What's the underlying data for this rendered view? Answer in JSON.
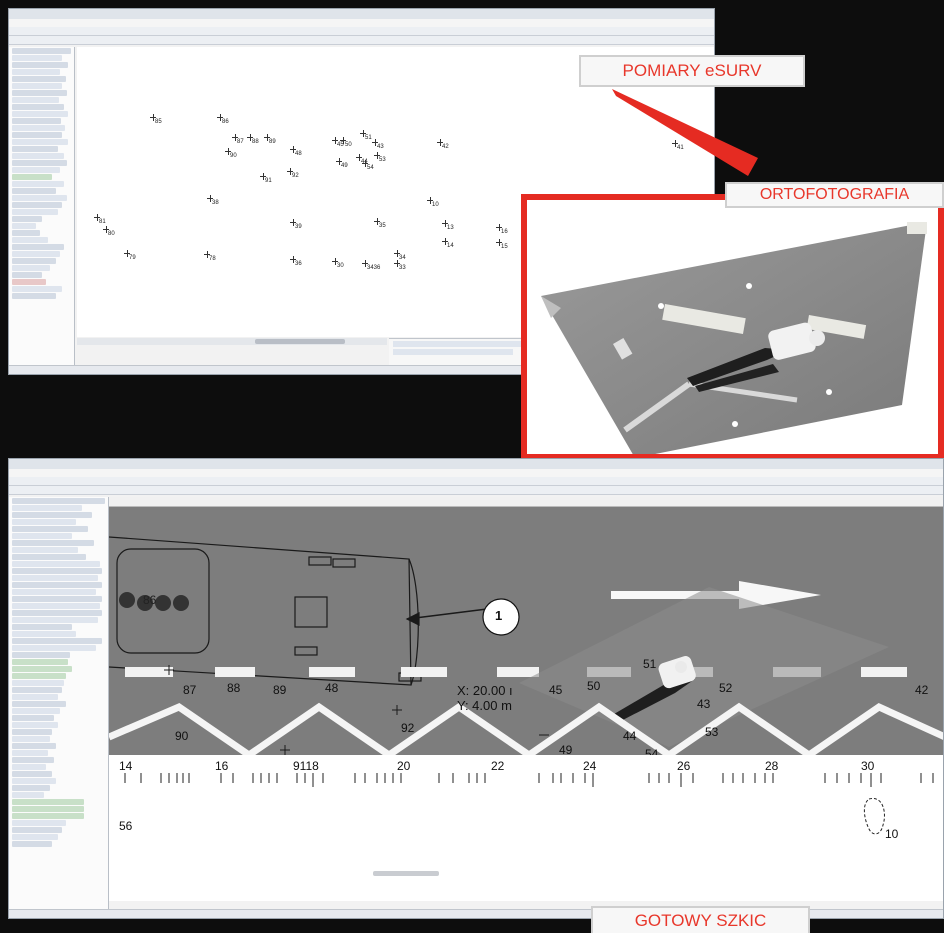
{
  "labels": {
    "top_right": "POMIARY eSURV",
    "ortho": "ORTOFOTOGRAFIA",
    "bottom": "GOTOWY SZKIC"
  },
  "top_window": {
    "points": [
      {
        "id": "pt-85",
        "label": "85"
      },
      {
        "id": "pt-86",
        "label": "86"
      },
      {
        "id": "pt-87",
        "label": "87"
      },
      {
        "id": "pt-88",
        "label": "88"
      },
      {
        "id": "pt-89",
        "label": "89"
      },
      {
        "id": "pt-90",
        "label": "90"
      },
      {
        "id": "pt-48",
        "label": "48"
      },
      {
        "id": "pt-92",
        "label": "92"
      },
      {
        "id": "pt-45",
        "label": "45"
      },
      {
        "id": "pt-50",
        "label": "50"
      },
      {
        "id": "pt-51",
        "label": "51"
      },
      {
        "id": "pt-42",
        "label": "42"
      },
      {
        "id": "pt-41",
        "label": "41"
      },
      {
        "id": "pt-43",
        "label": "43"
      },
      {
        "id": "pt-49",
        "label": "49"
      },
      {
        "id": "pt-44",
        "label": "44"
      },
      {
        "id": "pt-54",
        "label": "54"
      },
      {
        "id": "pt-53",
        "label": "53"
      },
      {
        "id": "pt-91",
        "label": "91"
      },
      {
        "id": "pt-38",
        "label": "38"
      },
      {
        "id": "pt-10",
        "label": "10"
      },
      {
        "id": "pt-81",
        "label": "81"
      },
      {
        "id": "pt-80",
        "label": "80"
      },
      {
        "id": "pt-39",
        "label": "39"
      },
      {
        "id": "pt-35",
        "label": "35"
      },
      {
        "id": "pt-13",
        "label": "13"
      },
      {
        "id": "pt-16",
        "label": "16"
      },
      {
        "id": "pt-14",
        "label": "14"
      },
      {
        "id": "pt-15",
        "label": "15"
      },
      {
        "id": "pt-79",
        "label": "79"
      },
      {
        "id": "pt-78",
        "label": "78"
      },
      {
        "id": "pt-36",
        "label": "36"
      },
      {
        "id": "pt-30",
        "label": "30"
      },
      {
        "id": "pt-3436",
        "label": "3436"
      },
      {
        "id": "pt-34",
        "label": "34"
      },
      {
        "id": "pt-33",
        "label": "33"
      }
    ]
  },
  "sketch": {
    "marker": "1",
    "coord_x": "X: 20.00 ı",
    "coord_y": "Y: 4.00 m",
    "lane_numbers": [
      "87",
      "88",
      "89",
      "48",
      "45",
      "50",
      "51",
      "52",
      "42",
      "43",
      "90",
      "92",
      "49",
      "44",
      "53",
      "54"
    ],
    "vehicle_label": "86",
    "scale": [
      "14",
      "16",
      "9118",
      "20",
      "22",
      "24",
      "26",
      "28",
      "30"
    ],
    "bottom_left": "56",
    "bottom_right": "10"
  }
}
